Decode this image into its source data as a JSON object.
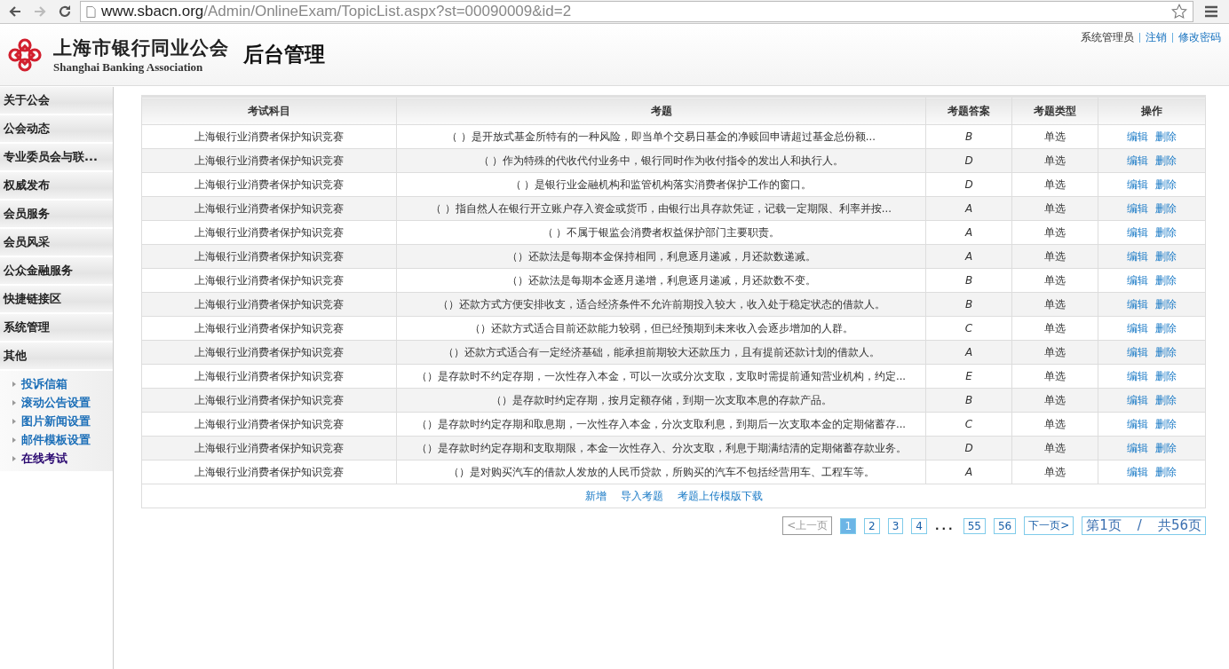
{
  "browser": {
    "url_host": "www.sbacn.org",
    "url_path": "/Admin/OnlineExam/TopicList.aspx?st=00090009&id=2"
  },
  "header": {
    "org_name": "上海市银行同业公会",
    "org_name_en": "Shanghai Banking Association",
    "title": "后台管理",
    "user": "系统管理员",
    "links": [
      "注销",
      "修改密码"
    ]
  },
  "sidebar": {
    "items": [
      {
        "label": "关于公会"
      },
      {
        "label": "公会动态"
      },
      {
        "label": "专业委员会与联..."
      },
      {
        "label": "权威发布"
      },
      {
        "label": "会员服务"
      },
      {
        "label": "会员风采"
      },
      {
        "label": "公众金融服务"
      },
      {
        "label": "快捷链接区"
      },
      {
        "label": "系统管理"
      },
      {
        "label": "其他",
        "children": [
          {
            "label": "投诉信箱",
            "selected": false
          },
          {
            "label": "滚动公告设置",
            "selected": false
          },
          {
            "label": "图片新闻设置",
            "selected": false
          },
          {
            "label": "邮件模板设置",
            "selected": false
          },
          {
            "label": "在线考试",
            "selected": true
          }
        ]
      }
    ]
  },
  "table": {
    "columns": [
      "考试科目",
      "考题",
      "考题答案",
      "考题类型",
      "操作"
    ],
    "rows": [
      {
        "subject": "上海银行业消费者保护知识竞赛",
        "question": "（ ）是开放式基金所特有的一种风险，即当单个交易日基金的净赎回申请超过基金总份额...",
        "answer": "B",
        "type": "单选",
        "actions": [
          "编辑",
          "删除"
        ]
      },
      {
        "subject": "上海银行业消费者保护知识竞赛",
        "question": "（ ）作为特殊的代收代付业务中，银行同时作为收付指令的发出人和执行人。",
        "answer": "D",
        "type": "单选",
        "actions": [
          "编辑",
          "删除"
        ]
      },
      {
        "subject": "上海银行业消费者保护知识竞赛",
        "question": "（ ）是银行业金融机构和监管机构落实消费者保护工作的窗口。",
        "answer": "D",
        "type": "单选",
        "actions": [
          "编辑",
          "删除"
        ]
      },
      {
        "subject": "上海银行业消费者保护知识竞赛",
        "question": "（ ）指自然人在银行开立账户存入资金或货币，由银行出具存款凭证，记载一定期限、利率并按...",
        "answer": "A",
        "type": "单选",
        "actions": [
          "编辑",
          "删除"
        ]
      },
      {
        "subject": "上海银行业消费者保护知识竞赛",
        "question": "（ ）不属于银监会消费者权益保护部门主要职责。",
        "answer": "A",
        "type": "单选",
        "actions": [
          "编辑",
          "删除"
        ]
      },
      {
        "subject": "上海银行业消费者保护知识竞赛",
        "question": "（）还款法是每期本金保持相同，利息逐月递减，月还款数递减。",
        "answer": "A",
        "type": "单选",
        "actions": [
          "编辑",
          "删除"
        ]
      },
      {
        "subject": "上海银行业消费者保护知识竞赛",
        "question": "（）还款法是每期本金逐月递增，利息逐月递减，月还款数不变。",
        "answer": "B",
        "type": "单选",
        "actions": [
          "编辑",
          "删除"
        ]
      },
      {
        "subject": "上海银行业消费者保护知识竞赛",
        "question": "（）还款方式方便安排收支，适合经济条件不允许前期投入较大，收入处于稳定状态的借款人。",
        "answer": "B",
        "type": "单选",
        "actions": [
          "编辑",
          "删除"
        ]
      },
      {
        "subject": "上海银行业消费者保护知识竞赛",
        "question": "（）还款方式适合目前还款能力较弱，但已经预期到未来收入会逐步增加的人群。",
        "answer": "C",
        "type": "单选",
        "actions": [
          "编辑",
          "删除"
        ]
      },
      {
        "subject": "上海银行业消费者保护知识竞赛",
        "question": "（）还款方式适合有一定经济基础，能承担前期较大还款压力，且有提前还款计划的借款人。",
        "answer": "A",
        "type": "单选",
        "actions": [
          "编辑",
          "删除"
        ]
      },
      {
        "subject": "上海银行业消费者保护知识竞赛",
        "question": "（）是存款时不约定存期，一次性存入本金，可以一次或分次支取，支取时需提前通知营业机构，约定...",
        "answer": "E",
        "type": "单选",
        "actions": [
          "编辑",
          "删除"
        ]
      },
      {
        "subject": "上海银行业消费者保护知识竞赛",
        "question": "（）是存款时约定存期，按月定额存储，到期一次支取本息的存款产品。",
        "answer": "B",
        "type": "单选",
        "actions": [
          "编辑",
          "删除"
        ]
      },
      {
        "subject": "上海银行业消费者保护知识竞赛",
        "question": "（）是存款时约定存期和取息期，一次性存入本金，分次支取利息，到期后一次支取本金的定期储蓄存...",
        "answer": "C",
        "type": "单选",
        "actions": [
          "编辑",
          "删除"
        ]
      },
      {
        "subject": "上海银行业消费者保护知识竞赛",
        "question": "（）是存款时约定存期和支取期限，本金一次性存入、分次支取，利息于期满结清的定期储蓄存款业务。",
        "answer": "D",
        "type": "单选",
        "actions": [
          "编辑",
          "删除"
        ]
      },
      {
        "subject": "上海银行业消费者保护知识竞赛",
        "question": "（）是对购买汽车的借款人发放的人民币贷款，所购买的汽车不包括经营用车、工程车等。",
        "answer": "A",
        "type": "单选",
        "actions": [
          "编辑",
          "删除"
        ]
      }
    ],
    "footer_links": [
      "新增",
      "导入考题",
      "考题上传模版下载"
    ]
  },
  "pager": {
    "prev": {
      "label": "<上一页",
      "disabled": true
    },
    "pages": [
      {
        "label": "1",
        "selected": true
      },
      {
        "label": "2",
        "selected": false
      },
      {
        "label": "3",
        "selected": false
      },
      {
        "label": "4",
        "selected": false
      },
      {
        "label": "...",
        "kind": "gap"
      },
      {
        "label": "55",
        "selected": false
      },
      {
        "label": "56",
        "selected": false
      }
    ],
    "next": {
      "label": "下一页>",
      "disabled": false
    },
    "info": {
      "current": "第1页",
      "separator": "/",
      "total": "共56页"
    }
  }
}
